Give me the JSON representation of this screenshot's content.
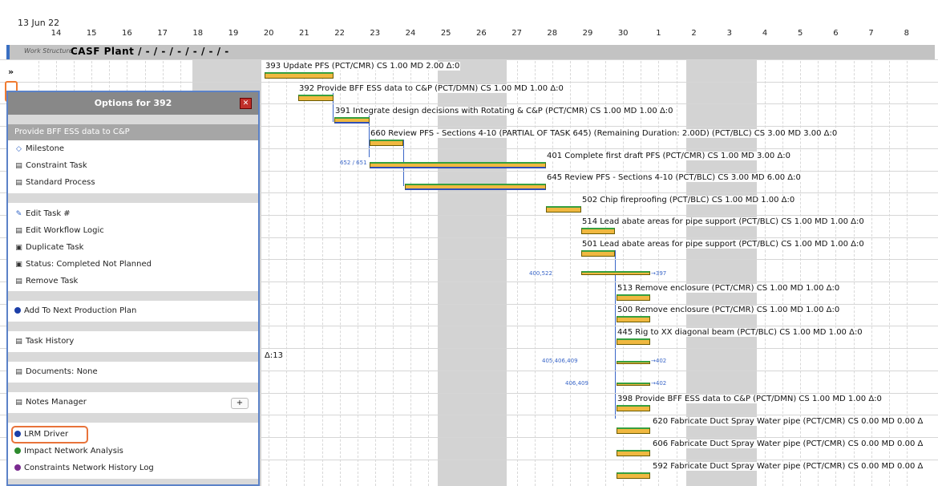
{
  "header": {
    "start_date": "13 Jun 22",
    "days": [
      "14",
      "15",
      "16",
      "17",
      "18",
      "19",
      "20",
      "21",
      "22",
      "23",
      "24",
      "25",
      "26",
      "27",
      "28",
      "29",
      "30",
      "1",
      "2",
      "3",
      "4",
      "5",
      "6",
      "7",
      "8"
    ]
  },
  "work_structure": {
    "label": "Work Structure -",
    "name": "CASF Plant / - / - / - / - / - / -"
  },
  "tasks": [
    {
      "label": "393 Update PFS (PCT/CMR)  CS 1.00  MD 2.00  Δ:0"
    },
    {
      "label": "392 Provide BFF ESS data to C&P (PCT/DMN)  CS 1.00  MD 1.00  Δ:0"
    },
    {
      "label": "391 Integrate design decisions with Rotating & C&P (PCT/CMR)  CS 1.00  MD 1.00  Δ:0"
    },
    {
      "label": "660 Review PFS - Sections 4-10 (PARTIAL OF TASK 645) (Remaining Duration: 2.00D) (PCT/BLC)  CS 3.00  MD 3.00  Δ:0"
    },
    {
      "label": "401 Complete first draft PFS (PCT/CMR)  CS 1.00  MD 3.00  Δ:0"
    },
    {
      "label": "645 Review PFS - Sections 4-10 (PCT/BLC)  CS 3.00  MD 6.00  Δ:0"
    },
    {
      "label": "502 Chip fireproofing (PCT/BLC)  CS 1.00  MD 1.00  Δ:0"
    },
    {
      "label": "514 Lead abate areas for pipe support (PCT/BLC)  CS 1.00  MD 1.00  Δ:0"
    },
    {
      "label": "501 Lead abate areas for pipe support (PCT/BLC)  CS 1.00  MD 1.00  Δ:0"
    },
    {
      "label": "513 Remove enclosure (PCT/CMR)  CS 1.00  MD 1.00  Δ:0"
    },
    {
      "label": "500 Remove enclosure (PCT/CMR)  CS 1.00  MD 1.00  Δ:0"
    },
    {
      "label": "445 Rig to XX diagonal beam (PCT/BLC)  CS 1.00  MD 1.00  Δ:0"
    },
    {
      "label": "398 Provide BFF ESS data to C&P (PCT/DMN)  CS 1.00  MD 1.00  Δ:0"
    },
    {
      "label": "620 Fabricate Duct Spray Water pipe (PCT/CMR)  CS 0.00  MD 0.00  Δ"
    },
    {
      "label": "606 Fabricate Duct Spray Water pipe (PCT/CMR)  CS 0.00  MD 0.00  Δ"
    },
    {
      "label": "592 Fabricate Duct Spray Water pipe (PCT/CMR)  CS 0.00  MD 0.00  Δ"
    }
  ],
  "misc_labels": {
    "delta13": "Δ:13",
    "pred_400_522": "400,522",
    "pred_405": "405,406,409",
    "pred_406": "406,409",
    "succ_397": "→397",
    "succ_402a": "→402",
    "succ_402b": "→402",
    "near_401": "652 / 651"
  },
  "options_panel": {
    "title": "Options for 392",
    "close": "✕",
    "task_name": "Provide BFF ESS data to C&P",
    "items": {
      "milestone": "Milestone",
      "constraint_task": "Constraint Task",
      "standard_process": "Standard Process",
      "edit_task": "Edit Task #",
      "edit_workflow": "Edit Workflow Logic",
      "duplicate_task": "Duplicate Task",
      "status": "Status: Completed Not Planned",
      "remove_task": "Remove Task",
      "add_production": "Add To Next Production Plan",
      "task_history": "Task History",
      "documents": "Documents: None",
      "notes_manager": "Notes Manager",
      "notes_add": "+",
      "lrm_driver": "LRM Driver",
      "impact_network": "Impact Network Analysis",
      "constraints_network": "Constraints Network History Log"
    },
    "icons": {
      "milestone": "diamond-icon",
      "constraint_task": "constraint-icon",
      "standard_process": "process-icon",
      "edit_task": "edit-icon",
      "edit_workflow": "workflow-icon",
      "duplicate_task": "duplicate-icon",
      "status": "status-icon",
      "remove_task": "remove-icon",
      "task_history": "history-icon",
      "documents": "document-icon",
      "notes_manager": "notes-icon"
    },
    "dot_colors": {
      "add_production": "#1d3fa8",
      "lrm_driver": "#1d3fa8",
      "impact_network": "#2e8b2e",
      "constraints_network": "#7a2a90"
    }
  }
}
